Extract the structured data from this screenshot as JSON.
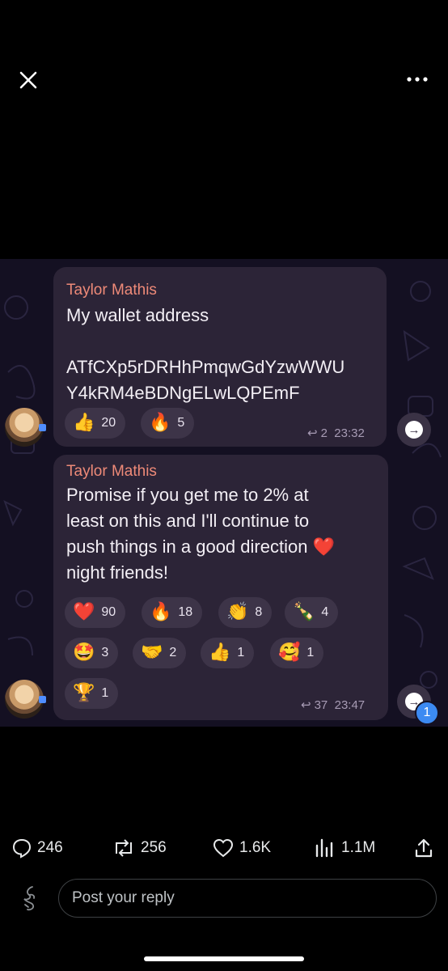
{
  "toolbar": {
    "close_icon": "close-icon",
    "more_icon": "more-horizontal-icon"
  },
  "messages": [
    {
      "sender": "Taylor Mathis",
      "text": "My wallet address\n\nATfCXp5rDRHhPmqwGdYzwWWU\nY4kRM4eBDNgELwLQPEmF",
      "reactions": [
        {
          "emoji": "👍",
          "count": "20"
        },
        {
          "emoji": "🔥",
          "count": "5"
        }
      ],
      "replies": "2",
      "time": "23:32"
    },
    {
      "sender": "Taylor Mathis",
      "text": "Promise if you get me to 2% at\nleast on this and I'll continue to\npush things in a good direction ❤️\nnight friends!",
      "reactions": [
        {
          "emoji": "❤️",
          "count": "90"
        },
        {
          "emoji": "🔥",
          "count": "18"
        },
        {
          "emoji": "👏",
          "count": "8"
        },
        {
          "emoji": "🍾",
          "count": "4"
        },
        {
          "emoji": "🤩",
          "count": "3"
        },
        {
          "emoji": "🤝",
          "count": "2"
        },
        {
          "emoji": "👍",
          "count": "1"
        },
        {
          "emoji": "🥰",
          "count": "1"
        },
        {
          "emoji": "🏆",
          "count": "1"
        }
      ],
      "replies": "37",
      "time": "23:47"
    }
  ],
  "unread_badge": "1",
  "engagement": {
    "replies": "246",
    "reposts": "256",
    "likes": "1.6K",
    "views": "1.1M"
  },
  "reply": {
    "placeholder": "Post your reply"
  },
  "colors": {
    "sender": "#ee8a78",
    "bubble": "#2c2437",
    "chip": "#3d3448",
    "accent_blue": "#3c8af2"
  }
}
